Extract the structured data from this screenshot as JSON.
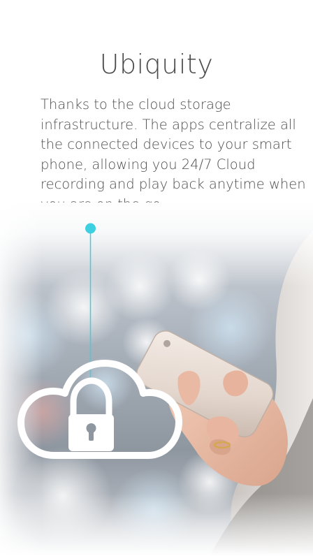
{
  "screen": {
    "title": "Ubiquity",
    "description": "Thanks to the cloud storage infrastructure. The apps centralize all the connected devices to your smart phone, allowing you 24/7 Cloud recording and play back anytime when you are on the go."
  },
  "colors": {
    "accent": "#3ed0e0",
    "title_text": "#4a4a4a",
    "body_text": "#4d4d4d",
    "icon": "#ffffff"
  },
  "icons": {
    "connector_dot": "dot-icon",
    "cloud_lock": "cloud-lock-icon"
  }
}
